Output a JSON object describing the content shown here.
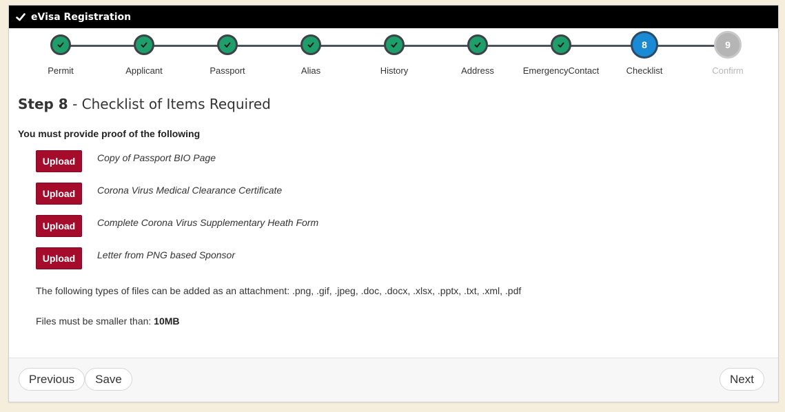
{
  "header": {
    "title": "eVisa Registration",
    "icon": "check-icon"
  },
  "steps": [
    {
      "label": "Permit",
      "state": "complete"
    },
    {
      "label": "Applicant",
      "state": "complete"
    },
    {
      "label": "Passport",
      "state": "complete"
    },
    {
      "label": "Alias",
      "state": "complete"
    },
    {
      "label": "History",
      "state": "complete"
    },
    {
      "label": "Address",
      "state": "complete"
    },
    {
      "label": "EmergencyContact",
      "state": "complete"
    },
    {
      "label": "Checklist",
      "state": "current",
      "number": "8"
    },
    {
      "label": "Confirm",
      "state": "upcoming",
      "number": "9"
    }
  ],
  "main": {
    "step_label": "Step 8",
    "step_title": " - Checklist of Items Required",
    "requirement_heading": "You must provide proof of the following",
    "items": [
      {
        "button": "Upload",
        "text": "Copy of Passport BIO Page"
      },
      {
        "button": "Upload",
        "text": "Corona Virus Medical Clearance Certificate"
      },
      {
        "button": "Upload",
        "text": "Complete Corona Virus Supplementary Heath Form"
      },
      {
        "button": "Upload",
        "text": "Letter from PNG based Sponsor"
      }
    ],
    "file_types_note": "The following types of files can be added as an attachment: .png, .gif, .jpeg, .doc, .docx, .xlsx, .pptx, .txt, .xml, .pdf",
    "size_note_prefix": "Files must be smaller than: ",
    "size_limit": "10MB"
  },
  "footer": {
    "previous_label": "Previous",
    "save_label": "Save",
    "next_label": "Next"
  },
  "colors": {
    "header_bg": "#000000",
    "step_complete": "#1e9e6a",
    "step_current": "#1a8ad4",
    "step_upcoming": "#b5b5b5",
    "upload_button": "#a50c2c",
    "page_bg": "#f5eedd"
  }
}
